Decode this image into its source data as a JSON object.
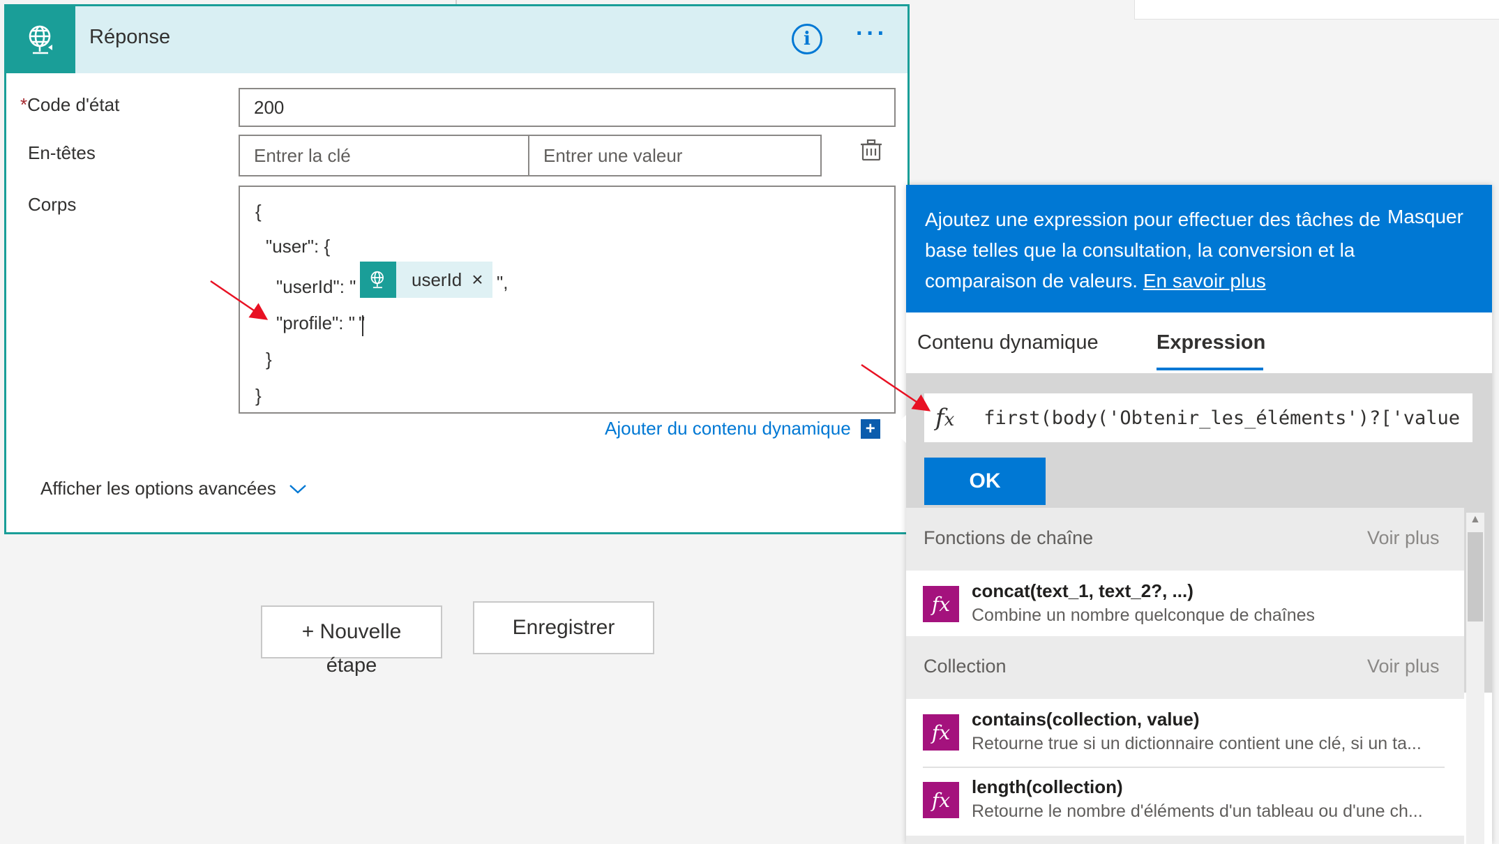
{
  "card": {
    "title": "Réponse",
    "required_mark": "*",
    "status_label": "Code d'état",
    "status_value": "200",
    "headers_label": "En-têtes",
    "key_placeholder": "Entrer la clé",
    "value_placeholder": "Entrer une valeur",
    "body_label": "Corps",
    "body_lines": {
      "l1": "{",
      "l2": "\"user\": {",
      "l3_prefix": "\"userId\": \"",
      "token_label": "userId",
      "token_close": "×",
      "l3_suffix": "\",",
      "l4": "\"profile\": \"",
      "l4_end": "\"",
      "l5": "}",
      "l6": "}"
    },
    "add_dynamic": "Ajouter du contenu dynamique",
    "add_dynamic_plus": "+",
    "advanced_options": "Afficher les options avancées"
  },
  "buttons": {
    "new_step_line1": "+ Nouvelle",
    "new_step_line2": "étape",
    "save": "Enregistrer"
  },
  "panel": {
    "description": "Ajoutez une expression pour effectuer des tâches de base telles que la consultation, la conversion et la comparaison de valeurs.",
    "learn_more": "En savoir plus",
    "hide": "Masquer",
    "tabs": [
      "Contenu dynamique",
      "Expression"
    ],
    "fx_symbol": "fx",
    "expression": "first(body('Obtenir_les_éléments')?['value",
    "ok": "OK",
    "categories": [
      {
        "title": "Fonctions de chaîne",
        "see_more": "Voir plus",
        "items": [
          {
            "name": "concat(text_1, text_2?, ...)",
            "desc": "Combine un nombre quelconque de chaînes"
          }
        ]
      },
      {
        "title": "Collection",
        "see_more": "Voir plus",
        "items": [
          {
            "name": "contains(collection, value)",
            "desc": "Retourne true si un dictionnaire contient une clé, si un ta..."
          },
          {
            "name": "length(collection)",
            "desc": "Retourne le nombre d'éléments d'un tableau ou d'une ch..."
          }
        ]
      }
    ]
  },
  "colors": {
    "teal": "#1a9e98",
    "header_bg": "#d9eff3",
    "blue": "#0078d4",
    "function_icon": "#a4127d",
    "annotation_arrow": "#e81123"
  }
}
